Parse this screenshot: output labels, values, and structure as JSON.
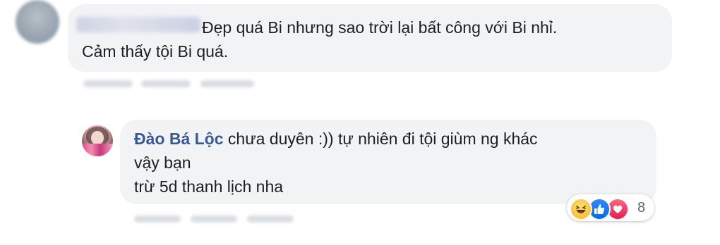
{
  "top_comment": {
    "line1": "Đẹp quá Bi nhưng sao trời lại bất công với Bi nhỉ.",
    "line2": "Cảm thấy tội Bi quá."
  },
  "reply": {
    "author": "Đào Bá Lộc",
    "line1_text": " chưa duyên :)) tự nhiên đi tội giùm ng khác",
    "line2": "vậy bạn",
    "line3": "trừ 5d thanh lịch nha",
    "reactions": {
      "icons": [
        "haha-icon",
        "like-icon",
        "love-icon"
      ],
      "count": "8"
    }
  },
  "colors": {
    "bubble": "#f2f3f5",
    "author": "#385898",
    "text": "#1c1e21"
  }
}
